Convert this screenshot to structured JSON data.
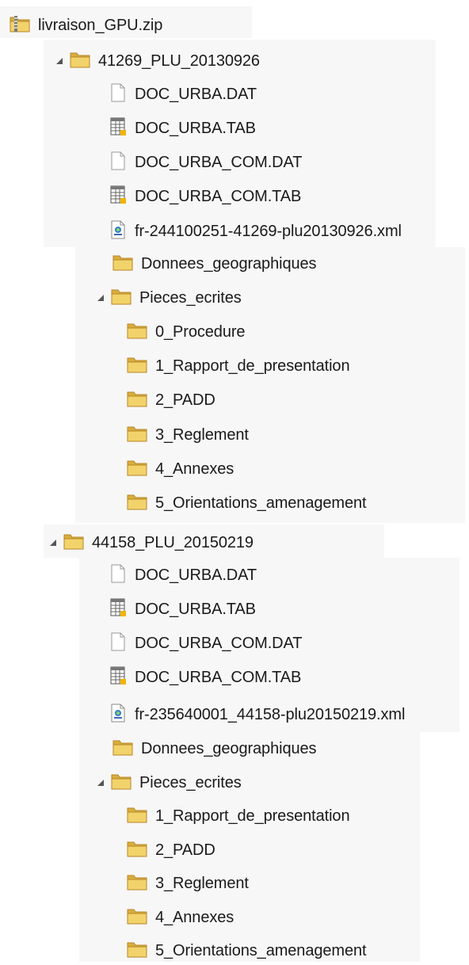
{
  "root": {
    "label": "livraison_GPU.zip",
    "icon": "zip-folder-icon"
  },
  "projects": [
    {
      "label": "41269_PLU_20130926",
      "files": [
        {
          "label": "DOC_URBA.DAT",
          "icon": "blank-file-icon"
        },
        {
          "label": "DOC_URBA.TAB",
          "icon": "table-file-icon"
        },
        {
          "label": "DOC_URBA_COM.DAT",
          "icon": "blank-file-icon"
        },
        {
          "label": "DOC_URBA_COM.TAB",
          "icon": "table-file-icon"
        },
        {
          "label": "fr-244100251-41269-plu20130926.xml",
          "icon": "xml-file-icon"
        }
      ],
      "geo_folder": "Donnees_geographiques",
      "pieces_folder": "Pieces_ecrites",
      "subfolders": [
        "0_Procedure",
        "1_Rapport_de_presentation",
        "2_PADD",
        "3_Reglement",
        "4_Annexes",
        "5_Orientations_amenagement"
      ]
    },
    {
      "label": "44158_PLU_20150219",
      "files": [
        {
          "label": "DOC_URBA.DAT",
          "icon": "blank-file-icon"
        },
        {
          "label": "DOC_URBA.TAB",
          "icon": "table-file-icon"
        },
        {
          "label": "DOC_URBA_COM.DAT",
          "icon": "blank-file-icon"
        },
        {
          "label": "DOC_URBA_COM.TAB",
          "icon": "table-file-icon"
        },
        {
          "label": "fr-235640001_44158-plu20150219.xml",
          "icon": "xml-file-icon"
        }
      ],
      "geo_folder": "Donnees_geographiques",
      "pieces_folder": "Pieces_ecrites",
      "subfolders": [
        "1_Rapport_de_presentation",
        "2_PADD",
        "3_Reglement",
        "4_Annexes",
        "5_Orientations_amenagement"
      ]
    }
  ],
  "colors": {
    "folder_front": "#f2d36b",
    "folder_back": "#d9ad3c",
    "folder_edge": "#b8862a",
    "panel_bg": "#f7f7f7",
    "arrow": "#555555"
  }
}
